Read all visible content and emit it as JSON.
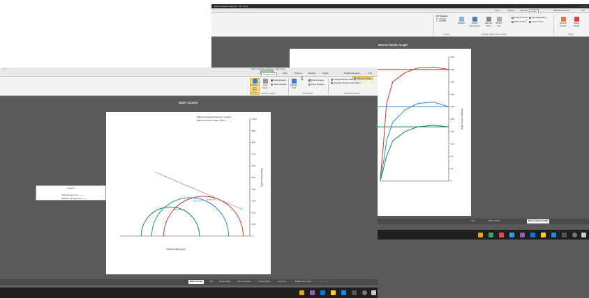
{
  "back_window": {
    "title": "Mohr-Coulomb-Criterion - PFC Time",
    "tabs": [
      "File",
      "Data/Parameters",
      "Graph",
      "Reports",
      "Options",
      "View"
    ],
    "active_tab": "Graph",
    "ribbon": {
      "xy_position": {
        "title": "XY Position",
        "x_label": "X",
        "x_value": "-20 531",
        "y_label": "Y",
        "y_value": "-24 585",
        "group": "Cursors"
      },
      "buttons": [
        "Redraw",
        "Visible Specimens",
        "Manual Zoom",
        "Scroll / Pan",
        "Displays"
      ],
      "checks": [
        "Smooth Curve",
        "Show Points",
        "Manual Scaling",
        "Invert Y-Axis",
        "Zoom"
      ],
      "groups": [
        "Graph",
        "Explorer (Stress-Strain Graph)",
        "Cursors"
      ],
      "right_buttons": [
        "Default Graphs",
        "Close Graph"
      ]
    },
    "chart_title": "Stress-Strain Graph",
    "sheet_tabs": [
      "Stress-Strain Graph",
      "Mohr Circles",
      "F/Q"
    ],
    "active_sheet": "Stress-Strain Graph"
  },
  "front_window": {
    "title": "Mohr-Coulomb-Criterion - PFC Time",
    "context_tab": "Graph Tool",
    "tabs": [
      "File",
      "Data/Parameters",
      "Graph",
      "Reports",
      "Options",
      "View",
      "Tangent Tool"
    ],
    "active_tab": "Tangent Tool",
    "ribbon": {
      "buttons": [
        "Display / Hide Mohr Circles",
        "Auto Draw",
        "Display Total",
        "Σ",
        "Draw Tangent",
        "Clear Tangent",
        "Draw Tangent",
        "Effective Stress"
      ],
      "small_items": [
        "Draw Tangent",
        "Clear Tangent",
        "Principal Stress Table",
        "Sheared Stress (Axial Strain)",
        "Effective Stress"
      ],
      "groups": [
        "Effective Tangent",
        "Total Tangent",
        "Calculation Method"
      ]
    },
    "chart_title": "Mohr Circles",
    "sheet_tabs": [
      "Mohr Circles",
      "F/Q",
      "Stress Ratio",
      "Pore Pressure",
      "Stress-Strain",
      "Log Time",
      "Square Root Time",
      "Summary"
    ],
    "active_sheet": "Mohr Circles"
  },
  "legend": {
    "title": "Legend",
    "items": [
      "Total Tangent Line",
      "Effective Tangent Line"
    ],
    "colors": [
      "#c0392b",
      "#333333"
    ]
  },
  "mohr_annotations": {
    "text_1": "Effective Strength Intercept = 20 kPa",
    "text_2": "Effective Friction Angle = 26.8 °",
    "circle_labels": [
      "Specimen 2",
      "Specimen 3",
      "Specimen 1"
    ]
  },
  "colors": {
    "series_red": "#c0392b",
    "series_blue": "#2e86de",
    "series_green": "#1e8449",
    "ribbon_context_green": "#7ab87a",
    "workspace": "#5a5a5a"
  },
  "chart_data": [
    {
      "type": "line",
      "title": "Stress-Strain Graph",
      "xlabel": "Axial Strain",
      "ylabel": "Deviator Stress (kPa)",
      "ylim": [
        0,
        400
      ],
      "yticks": [
        0,
        40,
        80,
        120,
        160,
        200,
        240,
        280,
        320,
        360,
        400
      ],
      "series": [
        {
          "color": "#c0392b",
          "x": [
            0,
            5,
            10,
            14,
            18,
            20,
            21,
            22
          ],
          "values": [
            360,
            368,
            365,
            350,
            320,
            250,
            120,
            10
          ]
        },
        {
          "color": "#2e86de",
          "x": [
            0,
            5,
            10,
            14,
            18,
            20,
            21,
            22
          ],
          "values": [
            240,
            255,
            250,
            230,
            190,
            130,
            60,
            5
          ]
        },
        {
          "color": "#1e8449",
          "x": [
            0,
            5,
            10,
            14,
            18,
            20,
            21,
            22
          ],
          "values": [
            175,
            180,
            175,
            160,
            130,
            80,
            40,
            0
          ]
        }
      ]
    },
    {
      "type": "scatter",
      "title": "Mohr Circles",
      "xlabel": "Normal Stress (psi)",
      "ylabel": "Shear Stress (kPa)",
      "ylim": [
        0,
        1000
      ],
      "yticks": [
        0,
        100,
        200,
        300,
        400,
        500,
        600,
        700,
        800,
        900,
        1000
      ],
      "circles": [
        {
          "color": "#c0392b",
          "center": 350,
          "radius": 300
        },
        {
          "color": "#2e86de",
          "center": 450,
          "radius": 290
        },
        {
          "color": "#1e8449",
          "center": 600,
          "radius": 220
        }
      ],
      "tangent_lines": [
        {
          "color": "#777777",
          "intercept": 20,
          "angle_deg": 26.8
        }
      ]
    }
  ]
}
